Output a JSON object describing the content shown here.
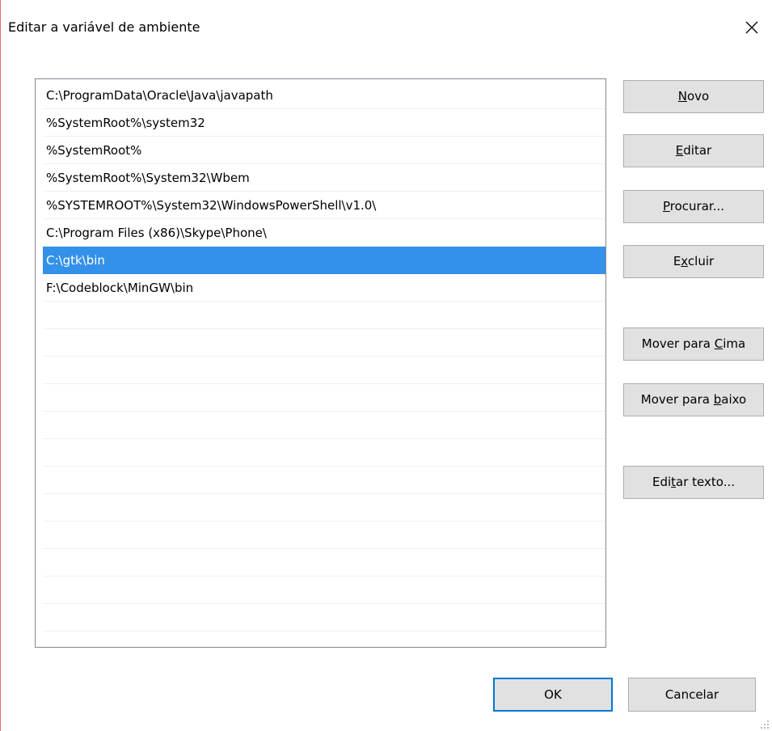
{
  "window": {
    "title": "Editar a variável de ambiente",
    "close_icon": "close-icon"
  },
  "path_list": {
    "items": [
      "C:\\ProgramData\\Oracle\\Java\\javapath",
      "%SystemRoot%\\system32",
      "%SystemRoot%",
      "%SystemRoot%\\System32\\Wbem",
      "%SYSTEMROOT%\\System32\\WindowsPowerShell\\v1.0\\",
      "C:\\Program Files (x86)\\Skype\\Phone\\",
      "C:\\gtk\\bin",
      "F:\\Codeblock\\MinGW\\bin"
    ],
    "selected_index": 6,
    "empty_rows": 13
  },
  "buttons": {
    "novo": {
      "pre": "",
      "acc": "N",
      "post": "ovo"
    },
    "editar": {
      "pre": "",
      "acc": "E",
      "post": "ditar"
    },
    "procurar": {
      "pre": "",
      "acc": "P",
      "post": "rocurar..."
    },
    "excluir": {
      "pre": "E",
      "acc": "x",
      "post": "cluir"
    },
    "mover_cima": {
      "pre": "Mover para ",
      "acc": "C",
      "post": "ima"
    },
    "mover_baixo": {
      "pre": "Mover para ",
      "acc": "b",
      "post": "aixo"
    },
    "editar_texto": {
      "pre": "Edi",
      "acc": "t",
      "post": "ar texto..."
    },
    "ok": "OK",
    "cancelar": "Cancelar"
  },
  "colors": {
    "selection": "#3391ea",
    "default_button_border": "#0078d7",
    "button_face": "#e1e1e1"
  }
}
